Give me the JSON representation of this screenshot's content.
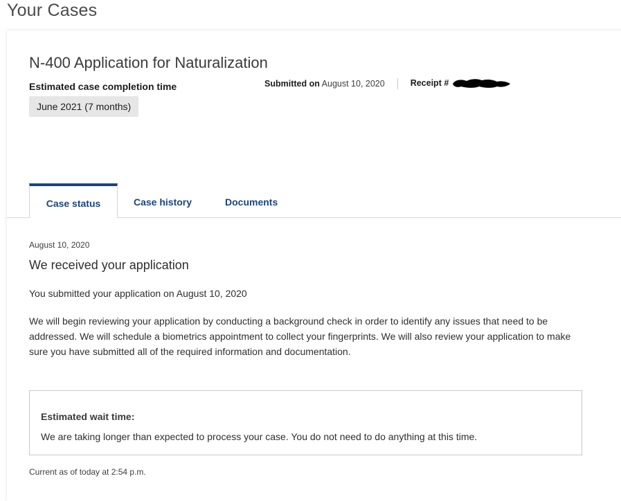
{
  "page": {
    "heading": "Your Cases"
  },
  "case": {
    "title": "N-400 Application for Naturalization",
    "estimated_label": "Estimated case completion time",
    "estimated_value": "June 2021 (7 months)",
    "submitted_label": "Submitted on",
    "submitted_date": "August 10, 2020",
    "receipt_label": "Receipt #"
  },
  "tabs": [
    {
      "label": "Case status",
      "active": true
    },
    {
      "label": "Case history",
      "active": false
    },
    {
      "label": "Documents",
      "active": false
    }
  ],
  "status": {
    "date": "August 10, 2020",
    "heading": "We received your application",
    "line": "You submitted your application on August 10, 2020",
    "description": "We will begin reviewing your application by conducting a background check in order to identify any issues that need to be addressed. We will schedule a biometrics appointment to collect your fingerprints. We will also review your application to make sure you have submitted all of the required information and documentation."
  },
  "wait": {
    "label": "Estimated wait time:",
    "text": "We are taking longer than expected to process your case. You do not need to do anything at this time."
  },
  "footer": {
    "current_as_of": "Current as of today at 2:54 p.m."
  },
  "colors": {
    "accent": "#1a4480",
    "badge_bg": "#e6e6e6",
    "border": "#d6d6d6"
  }
}
